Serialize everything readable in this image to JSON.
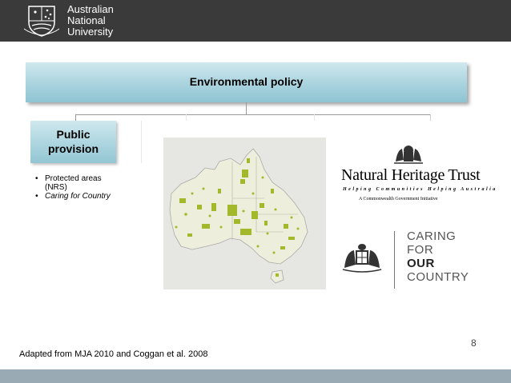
{
  "header": {
    "logo_lines": [
      "Australian",
      "National",
      "University"
    ]
  },
  "diagram": {
    "root_title": "Environmental policy",
    "branch_title": "Public provision",
    "bullets": [
      {
        "text": "Protected areas (NRS)",
        "italic": false
      },
      {
        "text": "Caring for Country",
        "italic": true
      }
    ]
  },
  "logos": {
    "nht": {
      "title": "Natural Heritage Trust",
      "tagline": "Helping Communities Helping Australia",
      "gov_line": "A Commonwealth Government Initiative"
    },
    "cfc": {
      "words": [
        "CARING",
        "FOR",
        "OUR",
        "COUNTRY"
      ]
    }
  },
  "slide": {
    "page_number": "8",
    "credit": "Adapted from MJA 2010 and Coggan et al. 2008"
  },
  "colors": {
    "header_bg": "#3a3a3a",
    "box_fill": "#a9d3de",
    "map_green": "#a3b82a",
    "map_land": "#eeeedd",
    "footer_bg": "#9aaab4"
  }
}
